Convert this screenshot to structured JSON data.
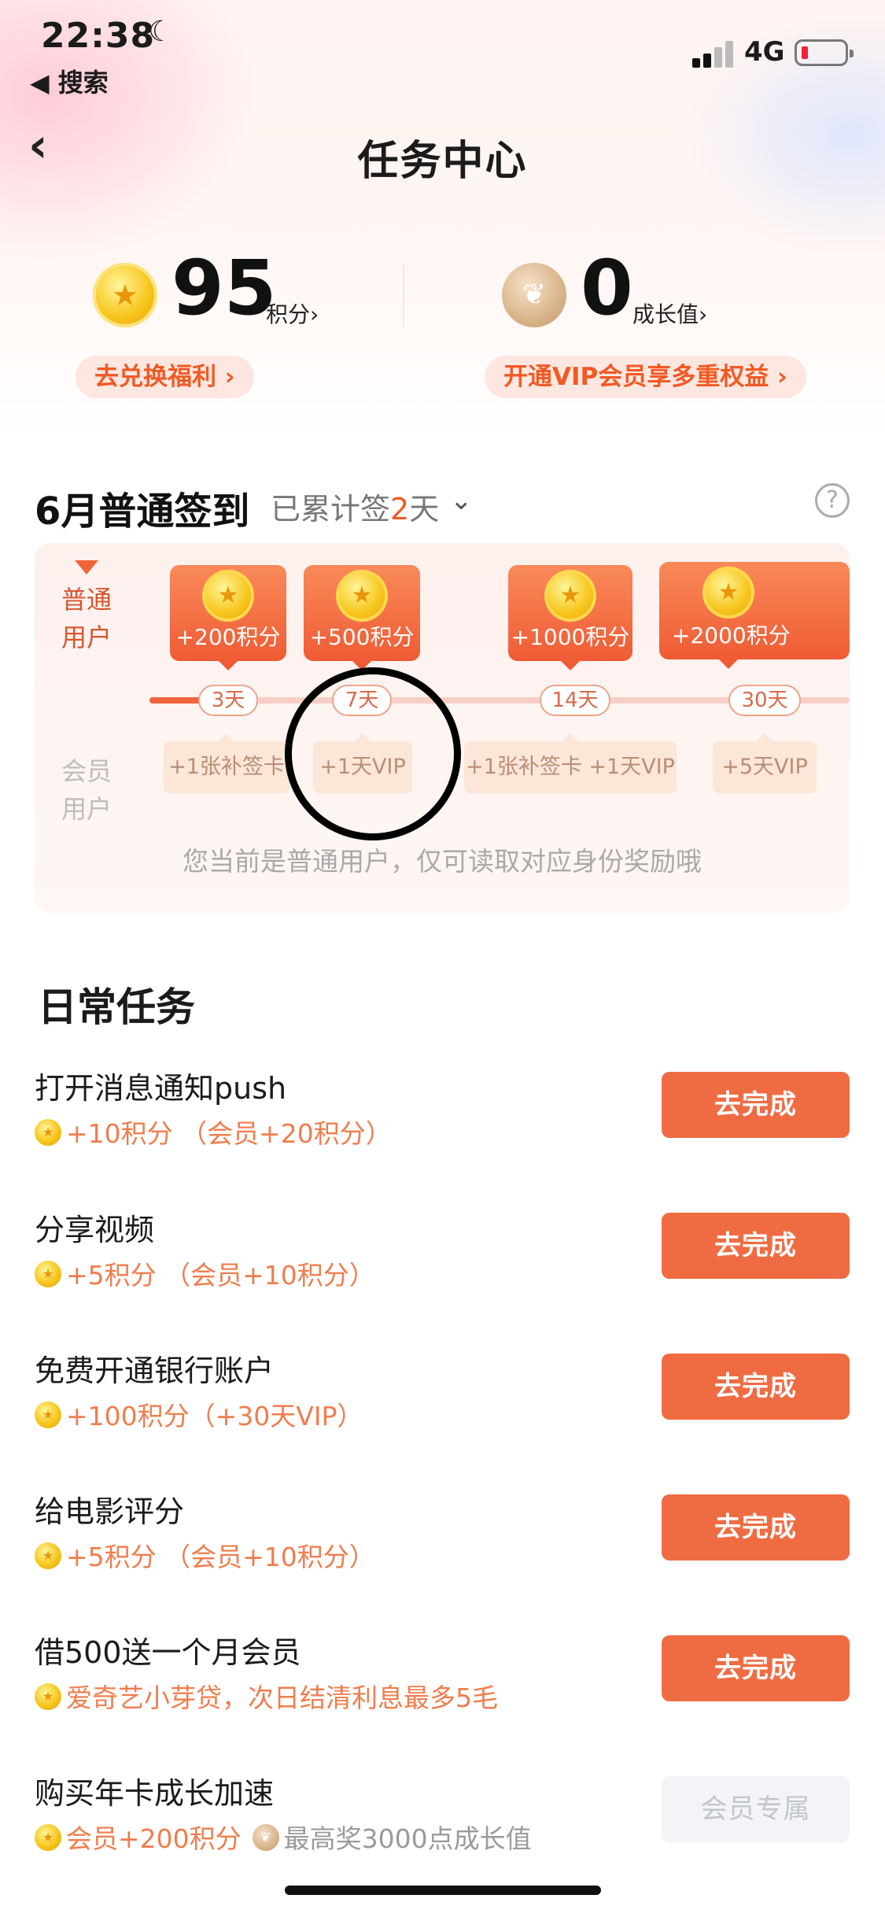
{
  "status_bar": {
    "time": "22:38",
    "back_app": "◀ 搜索",
    "network": "4G"
  },
  "nav": {
    "title": "任务中心"
  },
  "points": {
    "value": "95",
    "unit": "积分›",
    "link": "去兑换福利 ›"
  },
  "growth": {
    "value": "0",
    "unit": "成长值›",
    "link": "开通VIP会员享多重权益 ›"
  },
  "signin": {
    "title": "6月普通签到",
    "sub_prefix": "已累计签",
    "sub_days": "2",
    "sub_suffix": "天",
    "normal_label_1": "普通",
    "normal_label_2": "用户",
    "member_label_1": "会员",
    "member_label_2": "用户",
    "rewards": [
      "+200积分",
      "+500积分",
      "+1000积分",
      "+2000积分"
    ],
    "days": [
      "3天",
      "7天",
      "14天",
      "30天"
    ],
    "vip_rewards": [
      "+1张补签卡",
      "+1天VIP",
      "+1张补签卡 +1天VIP",
      "+5天VIP"
    ],
    "note": "您当前是普通用户，仅可读取对应身份奖励哦"
  },
  "daily": {
    "title": "日常任务",
    "tasks": [
      {
        "name": "打开消息通知push",
        "reward": "+10积分 （会员+20积分）",
        "button": "去完成"
      },
      {
        "name": "分享视频",
        "reward": "+5积分 （会员+10积分）",
        "button": "去完成"
      },
      {
        "name": "免费开通银行账户",
        "reward": "+100积分（+30天VIP）",
        "button": "去完成"
      },
      {
        "name": "给电影评分",
        "reward": "+5积分 （会员+10积分）",
        "button": "去完成"
      },
      {
        "name": "借500送一个月会员",
        "reward": "爱奇艺小芽贷，次日结清利息最多5毛",
        "button": "去完成"
      },
      {
        "name": "购买年卡成长加速",
        "reward": "会员+200积分",
        "reward_extra": "最高奖3000点成长值",
        "button": "会员专属"
      }
    ]
  },
  "colors": {
    "accent": "#ef6c43",
    "accent_text": "#f15a24"
  }
}
